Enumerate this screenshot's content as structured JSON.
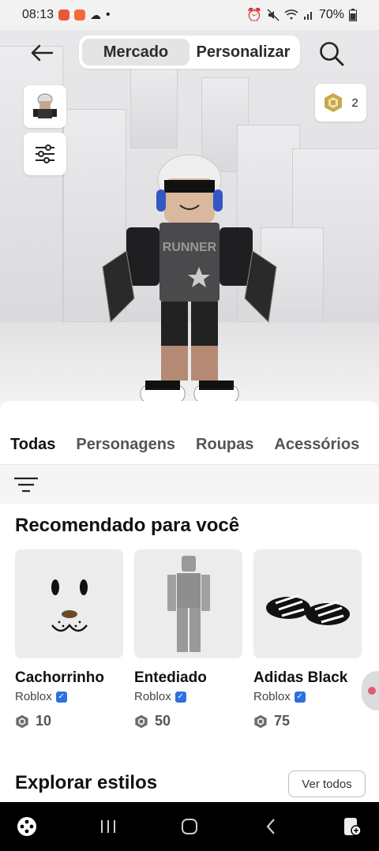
{
  "status_bar": {
    "time": "08:13",
    "battery": "70%",
    "dot": "•"
  },
  "header": {
    "back_icon": "arrow-left-icon",
    "tabs": [
      {
        "label": "Mercado",
        "active": true
      },
      {
        "label": "Personalizar",
        "active": false
      }
    ],
    "search_icon": "search-icon"
  },
  "robux": {
    "icon": "robux-icon",
    "balance": "2"
  },
  "categories": {
    "tabs": [
      {
        "label": "Todas",
        "active": true
      },
      {
        "label": "Personagens",
        "active": false
      },
      {
        "label": "Roupas",
        "active": false
      },
      {
        "label": "Acessórios",
        "active": false
      }
    ]
  },
  "recommended": {
    "title": "Recomendado para você",
    "items": [
      {
        "name": "Cachorrinho",
        "creator": "Roblox",
        "price": "10"
      },
      {
        "name": "Entediado",
        "creator": "Roblox",
        "price": "50"
      },
      {
        "name": "Adidas Black",
        "creator": "Roblox",
        "price": "75"
      }
    ]
  },
  "explore": {
    "title": "Explorar estilos",
    "see_all": "Ver todos"
  },
  "colors": {
    "accent_verified": "#2f6fe0",
    "sheet_bg": "#ffffff",
    "scene_bg": "#e3e3e5"
  }
}
